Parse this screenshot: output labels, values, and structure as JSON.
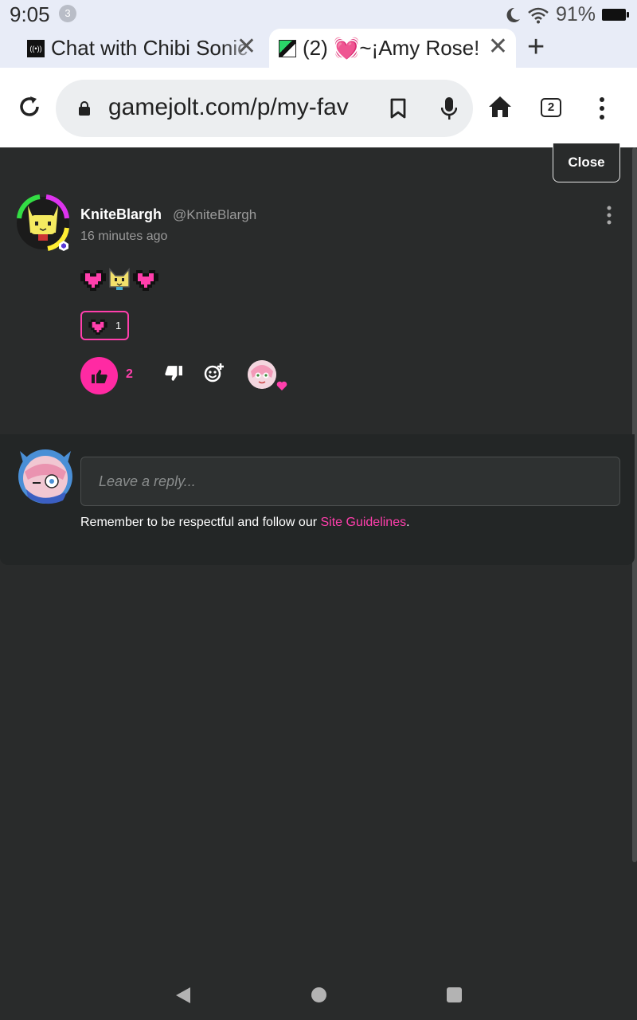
{
  "status_bar": {
    "time": "9:05",
    "notification_count": "3",
    "battery_percent": "91%"
  },
  "tabs": [
    {
      "title": "Chat with Chibi Sonic",
      "close": "✕"
    },
    {
      "title": "(2) 💓~¡Amy Rose!",
      "close": "✕"
    }
  ],
  "new_tab_label": "+",
  "toolbar": {
    "url": "gamejolt.com/p/my-fav",
    "tab_count": "2"
  },
  "modal": {
    "close_label": "Close"
  },
  "comment": {
    "username": "KniteBlargh",
    "handle": "@KniteBlargh",
    "timestamp": "16 minutes ago",
    "reaction_count": "1",
    "like_count": "2"
  },
  "reply": {
    "placeholder": "Leave a reply...",
    "guidelines_text": "Remember to be respectful and follow our ",
    "guidelines_link": "Site Guidelines",
    "guidelines_suffix": "."
  },
  "colors": {
    "accent": "#ff2aa3",
    "background": "#292b2b",
    "panel": "#232626"
  }
}
